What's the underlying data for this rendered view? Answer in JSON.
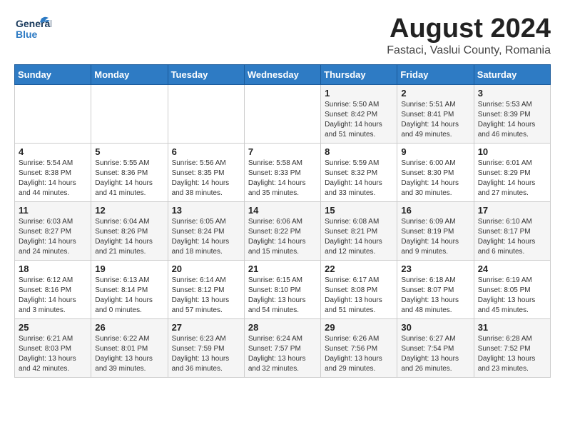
{
  "header": {
    "logo_line1": "General",
    "logo_line2": "Blue",
    "month_year": "August 2024",
    "location": "Fastaci, Vaslui County, Romania"
  },
  "days_of_week": [
    "Sunday",
    "Monday",
    "Tuesday",
    "Wednesday",
    "Thursday",
    "Friday",
    "Saturday"
  ],
  "weeks": [
    [
      {
        "day": "",
        "info": ""
      },
      {
        "day": "",
        "info": ""
      },
      {
        "day": "",
        "info": ""
      },
      {
        "day": "",
        "info": ""
      },
      {
        "day": "1",
        "info": "Sunrise: 5:50 AM\nSunset: 8:42 PM\nDaylight: 14 hours\nand 51 minutes."
      },
      {
        "day": "2",
        "info": "Sunrise: 5:51 AM\nSunset: 8:41 PM\nDaylight: 14 hours\nand 49 minutes."
      },
      {
        "day": "3",
        "info": "Sunrise: 5:53 AM\nSunset: 8:39 PM\nDaylight: 14 hours\nand 46 minutes."
      }
    ],
    [
      {
        "day": "4",
        "info": "Sunrise: 5:54 AM\nSunset: 8:38 PM\nDaylight: 14 hours\nand 44 minutes."
      },
      {
        "day": "5",
        "info": "Sunrise: 5:55 AM\nSunset: 8:36 PM\nDaylight: 14 hours\nand 41 minutes."
      },
      {
        "day": "6",
        "info": "Sunrise: 5:56 AM\nSunset: 8:35 PM\nDaylight: 14 hours\nand 38 minutes."
      },
      {
        "day": "7",
        "info": "Sunrise: 5:58 AM\nSunset: 8:33 PM\nDaylight: 14 hours\nand 35 minutes."
      },
      {
        "day": "8",
        "info": "Sunrise: 5:59 AM\nSunset: 8:32 PM\nDaylight: 14 hours\nand 33 minutes."
      },
      {
        "day": "9",
        "info": "Sunrise: 6:00 AM\nSunset: 8:30 PM\nDaylight: 14 hours\nand 30 minutes."
      },
      {
        "day": "10",
        "info": "Sunrise: 6:01 AM\nSunset: 8:29 PM\nDaylight: 14 hours\nand 27 minutes."
      }
    ],
    [
      {
        "day": "11",
        "info": "Sunrise: 6:03 AM\nSunset: 8:27 PM\nDaylight: 14 hours\nand 24 minutes."
      },
      {
        "day": "12",
        "info": "Sunrise: 6:04 AM\nSunset: 8:26 PM\nDaylight: 14 hours\nand 21 minutes."
      },
      {
        "day": "13",
        "info": "Sunrise: 6:05 AM\nSunset: 8:24 PM\nDaylight: 14 hours\nand 18 minutes."
      },
      {
        "day": "14",
        "info": "Sunrise: 6:06 AM\nSunset: 8:22 PM\nDaylight: 14 hours\nand 15 minutes."
      },
      {
        "day": "15",
        "info": "Sunrise: 6:08 AM\nSunset: 8:21 PM\nDaylight: 14 hours\nand 12 minutes."
      },
      {
        "day": "16",
        "info": "Sunrise: 6:09 AM\nSunset: 8:19 PM\nDaylight: 14 hours\nand 9 minutes."
      },
      {
        "day": "17",
        "info": "Sunrise: 6:10 AM\nSunset: 8:17 PM\nDaylight: 14 hours\nand 6 minutes."
      }
    ],
    [
      {
        "day": "18",
        "info": "Sunrise: 6:12 AM\nSunset: 8:16 PM\nDaylight: 14 hours\nand 3 minutes."
      },
      {
        "day": "19",
        "info": "Sunrise: 6:13 AM\nSunset: 8:14 PM\nDaylight: 14 hours\nand 0 minutes."
      },
      {
        "day": "20",
        "info": "Sunrise: 6:14 AM\nSunset: 8:12 PM\nDaylight: 13 hours\nand 57 minutes."
      },
      {
        "day": "21",
        "info": "Sunrise: 6:15 AM\nSunset: 8:10 PM\nDaylight: 13 hours\nand 54 minutes."
      },
      {
        "day": "22",
        "info": "Sunrise: 6:17 AM\nSunset: 8:08 PM\nDaylight: 13 hours\nand 51 minutes."
      },
      {
        "day": "23",
        "info": "Sunrise: 6:18 AM\nSunset: 8:07 PM\nDaylight: 13 hours\nand 48 minutes."
      },
      {
        "day": "24",
        "info": "Sunrise: 6:19 AM\nSunset: 8:05 PM\nDaylight: 13 hours\nand 45 minutes."
      }
    ],
    [
      {
        "day": "25",
        "info": "Sunrise: 6:21 AM\nSunset: 8:03 PM\nDaylight: 13 hours\nand 42 minutes."
      },
      {
        "day": "26",
        "info": "Sunrise: 6:22 AM\nSunset: 8:01 PM\nDaylight: 13 hours\nand 39 minutes."
      },
      {
        "day": "27",
        "info": "Sunrise: 6:23 AM\nSunset: 7:59 PM\nDaylight: 13 hours\nand 36 minutes."
      },
      {
        "day": "28",
        "info": "Sunrise: 6:24 AM\nSunset: 7:57 PM\nDaylight: 13 hours\nand 32 minutes."
      },
      {
        "day": "29",
        "info": "Sunrise: 6:26 AM\nSunset: 7:56 PM\nDaylight: 13 hours\nand 29 minutes."
      },
      {
        "day": "30",
        "info": "Sunrise: 6:27 AM\nSunset: 7:54 PM\nDaylight: 13 hours\nand 26 minutes."
      },
      {
        "day": "31",
        "info": "Sunrise: 6:28 AM\nSunset: 7:52 PM\nDaylight: 13 hours\nand 23 minutes."
      }
    ]
  ]
}
